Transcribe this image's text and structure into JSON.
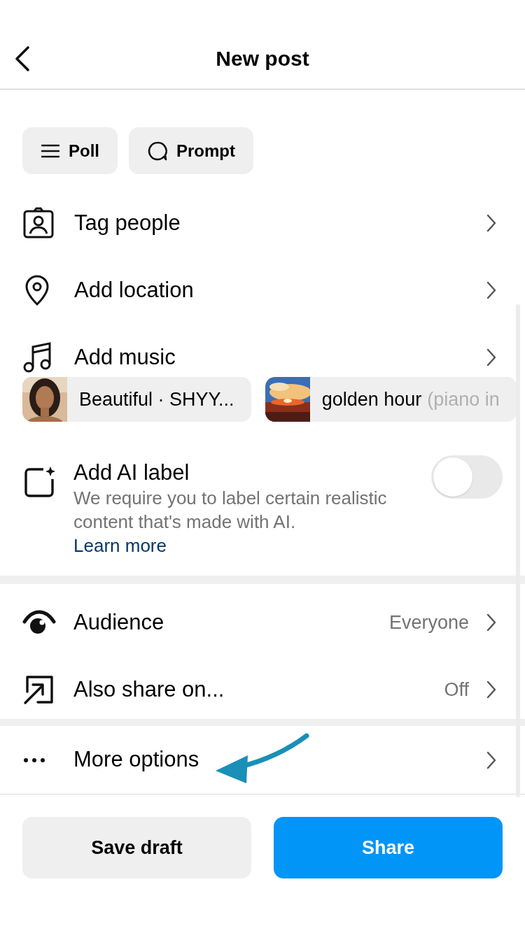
{
  "header": {
    "title": "New post"
  },
  "post_types": [
    {
      "kind": "poll",
      "label": "Poll"
    },
    {
      "kind": "prompt",
      "label": "Prompt"
    }
  ],
  "rows": [
    {
      "kind": "tag",
      "label": "Tag people"
    },
    {
      "kind": "location",
      "label": "Add location"
    },
    {
      "kind": "music",
      "label": "Add music"
    }
  ],
  "music_chips": [
    {
      "kind": "portrait",
      "title": "Beautiful · SHYY..."
    },
    {
      "kind": "sunset",
      "title": "golden hour",
      "subtitle": "(piano in"
    }
  ],
  "ai_label": {
    "title": "Add AI label",
    "description": "We require you to label certain realistic content that's made with AI.",
    "link": "Learn more",
    "on": false
  },
  "settings": [
    {
      "kind": "audience",
      "label": "Audience",
      "value": "Everyone"
    },
    {
      "kind": "share",
      "label": "Also share on...",
      "value": "Off"
    }
  ],
  "more": {
    "label": "More options"
  },
  "buttons": [
    {
      "kind": "secondary",
      "label": "Save draft"
    },
    {
      "kind": "primary",
      "label": "Share"
    }
  ]
}
